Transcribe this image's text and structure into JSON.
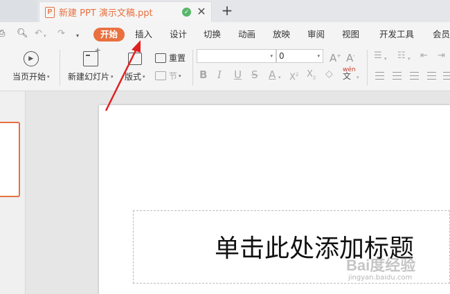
{
  "document_tab": {
    "icon": "ppt-icon",
    "title": "新建 PPT 演示文稿.ppt"
  },
  "menu": {
    "items": [
      {
        "label": "开始",
        "active": true
      },
      {
        "label": "插入"
      },
      {
        "label": "设计"
      },
      {
        "label": "切换"
      },
      {
        "label": "动画"
      },
      {
        "label": "放映"
      },
      {
        "label": "审阅"
      },
      {
        "label": "视图"
      },
      {
        "label": "开发工具"
      },
      {
        "label": "会员"
      }
    ]
  },
  "ribbon": {
    "play_from_current": "当页开始",
    "new_slide": "新建幻灯片",
    "layout": "版式",
    "reset": "重置",
    "section": "节",
    "font_name": "",
    "font_size": "0",
    "phonetic_glyph": "wén"
  },
  "slide": {
    "title_placeholder": "单击此处添加标题"
  },
  "watermark": {
    "logo": "Bai度经验",
    "url": "jingyan.baidu.com"
  },
  "colors": {
    "accent": "#e9703f",
    "annotation_arrow": "#e02020"
  }
}
